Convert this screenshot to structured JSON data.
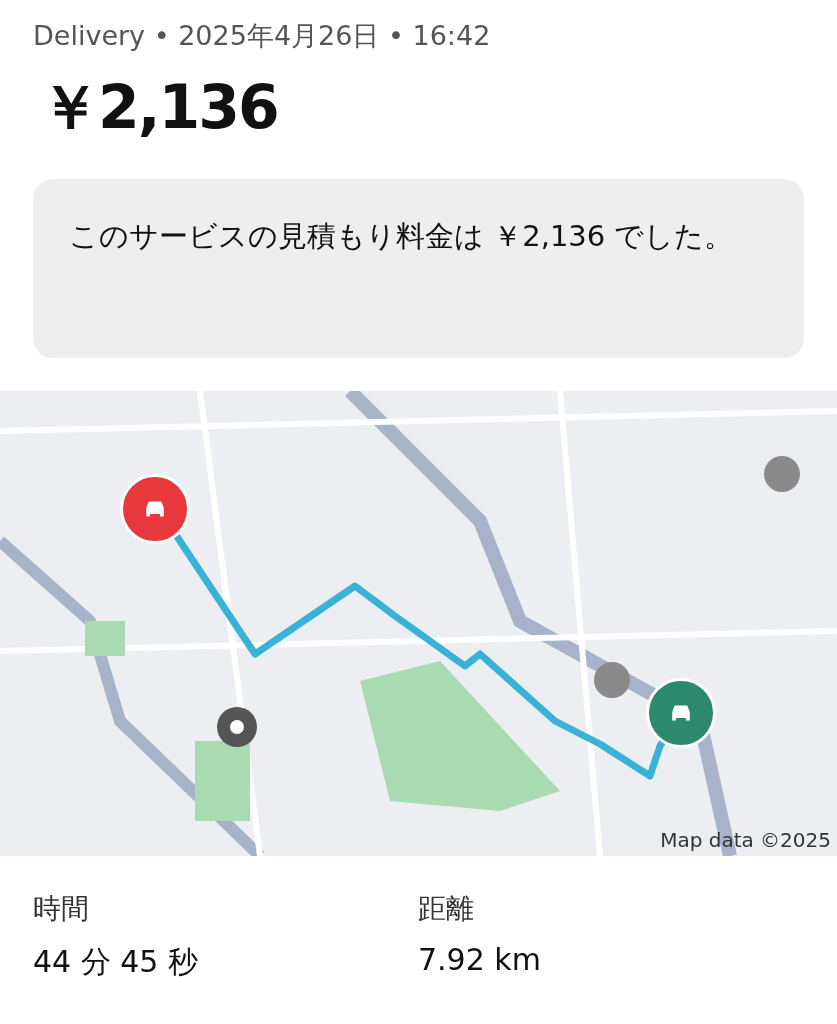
{
  "header": "Delivery • 2025年4月26日 • 16:42",
  "price": "￥2,136",
  "notice": "このサービスの見積もり料金は ￥2,136 でした。",
  "map": {
    "attribution": "Map data ©2025",
    "markers": [
      {
        "kind": "pickup",
        "color": "#e8383d"
      },
      {
        "kind": "dropoff",
        "color": "#2b8a6c"
      }
    ]
  },
  "stats": [
    {
      "label": "時間",
      "value": "44 分 45 秒"
    },
    {
      "label": "距離",
      "value": "7.92 km"
    }
  ]
}
